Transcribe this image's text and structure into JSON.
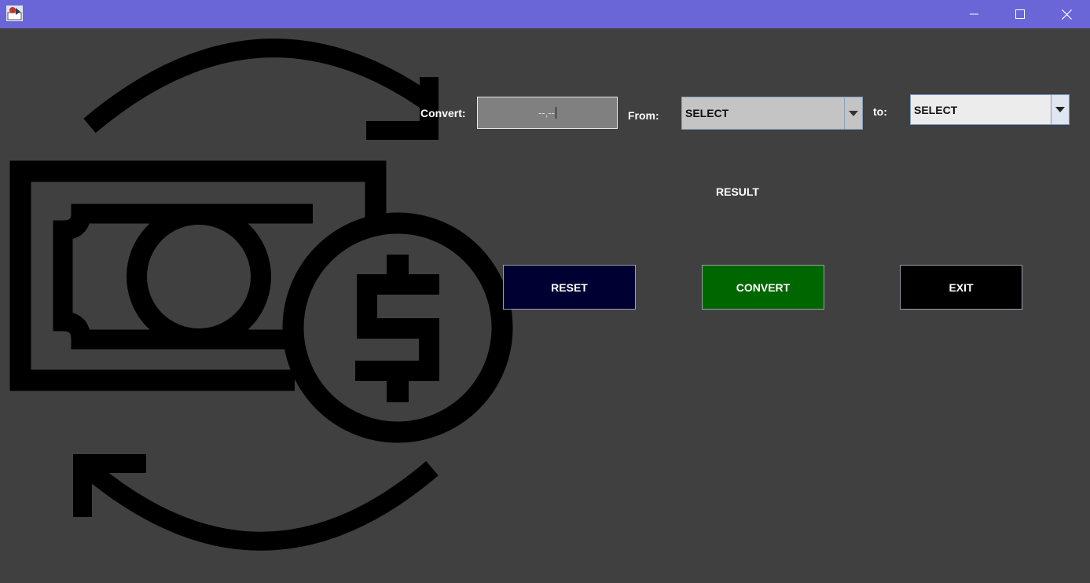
{
  "window": {
    "title_bar_color": "#6b66d8",
    "app_icon": "java-app-icon",
    "controls": {
      "minimize_icon": "minimize-icon",
      "maximize_icon": "maximize-icon",
      "close_icon": "close-icon"
    }
  },
  "background_art": "money-exchange-icon",
  "form": {
    "convert_label": "Convert:",
    "amount_value": "--,--",
    "from_label": "From:",
    "from_selected": "SELECT",
    "to_label": "to:",
    "to_selected": "SELECT"
  },
  "result": {
    "text": "RESULT"
  },
  "buttons": {
    "reset": {
      "label": "RESET",
      "color": "#000033"
    },
    "convert": {
      "label": "CONVERT",
      "color": "#006600"
    },
    "exit": {
      "label": "EXIT",
      "color": "#000000"
    }
  }
}
